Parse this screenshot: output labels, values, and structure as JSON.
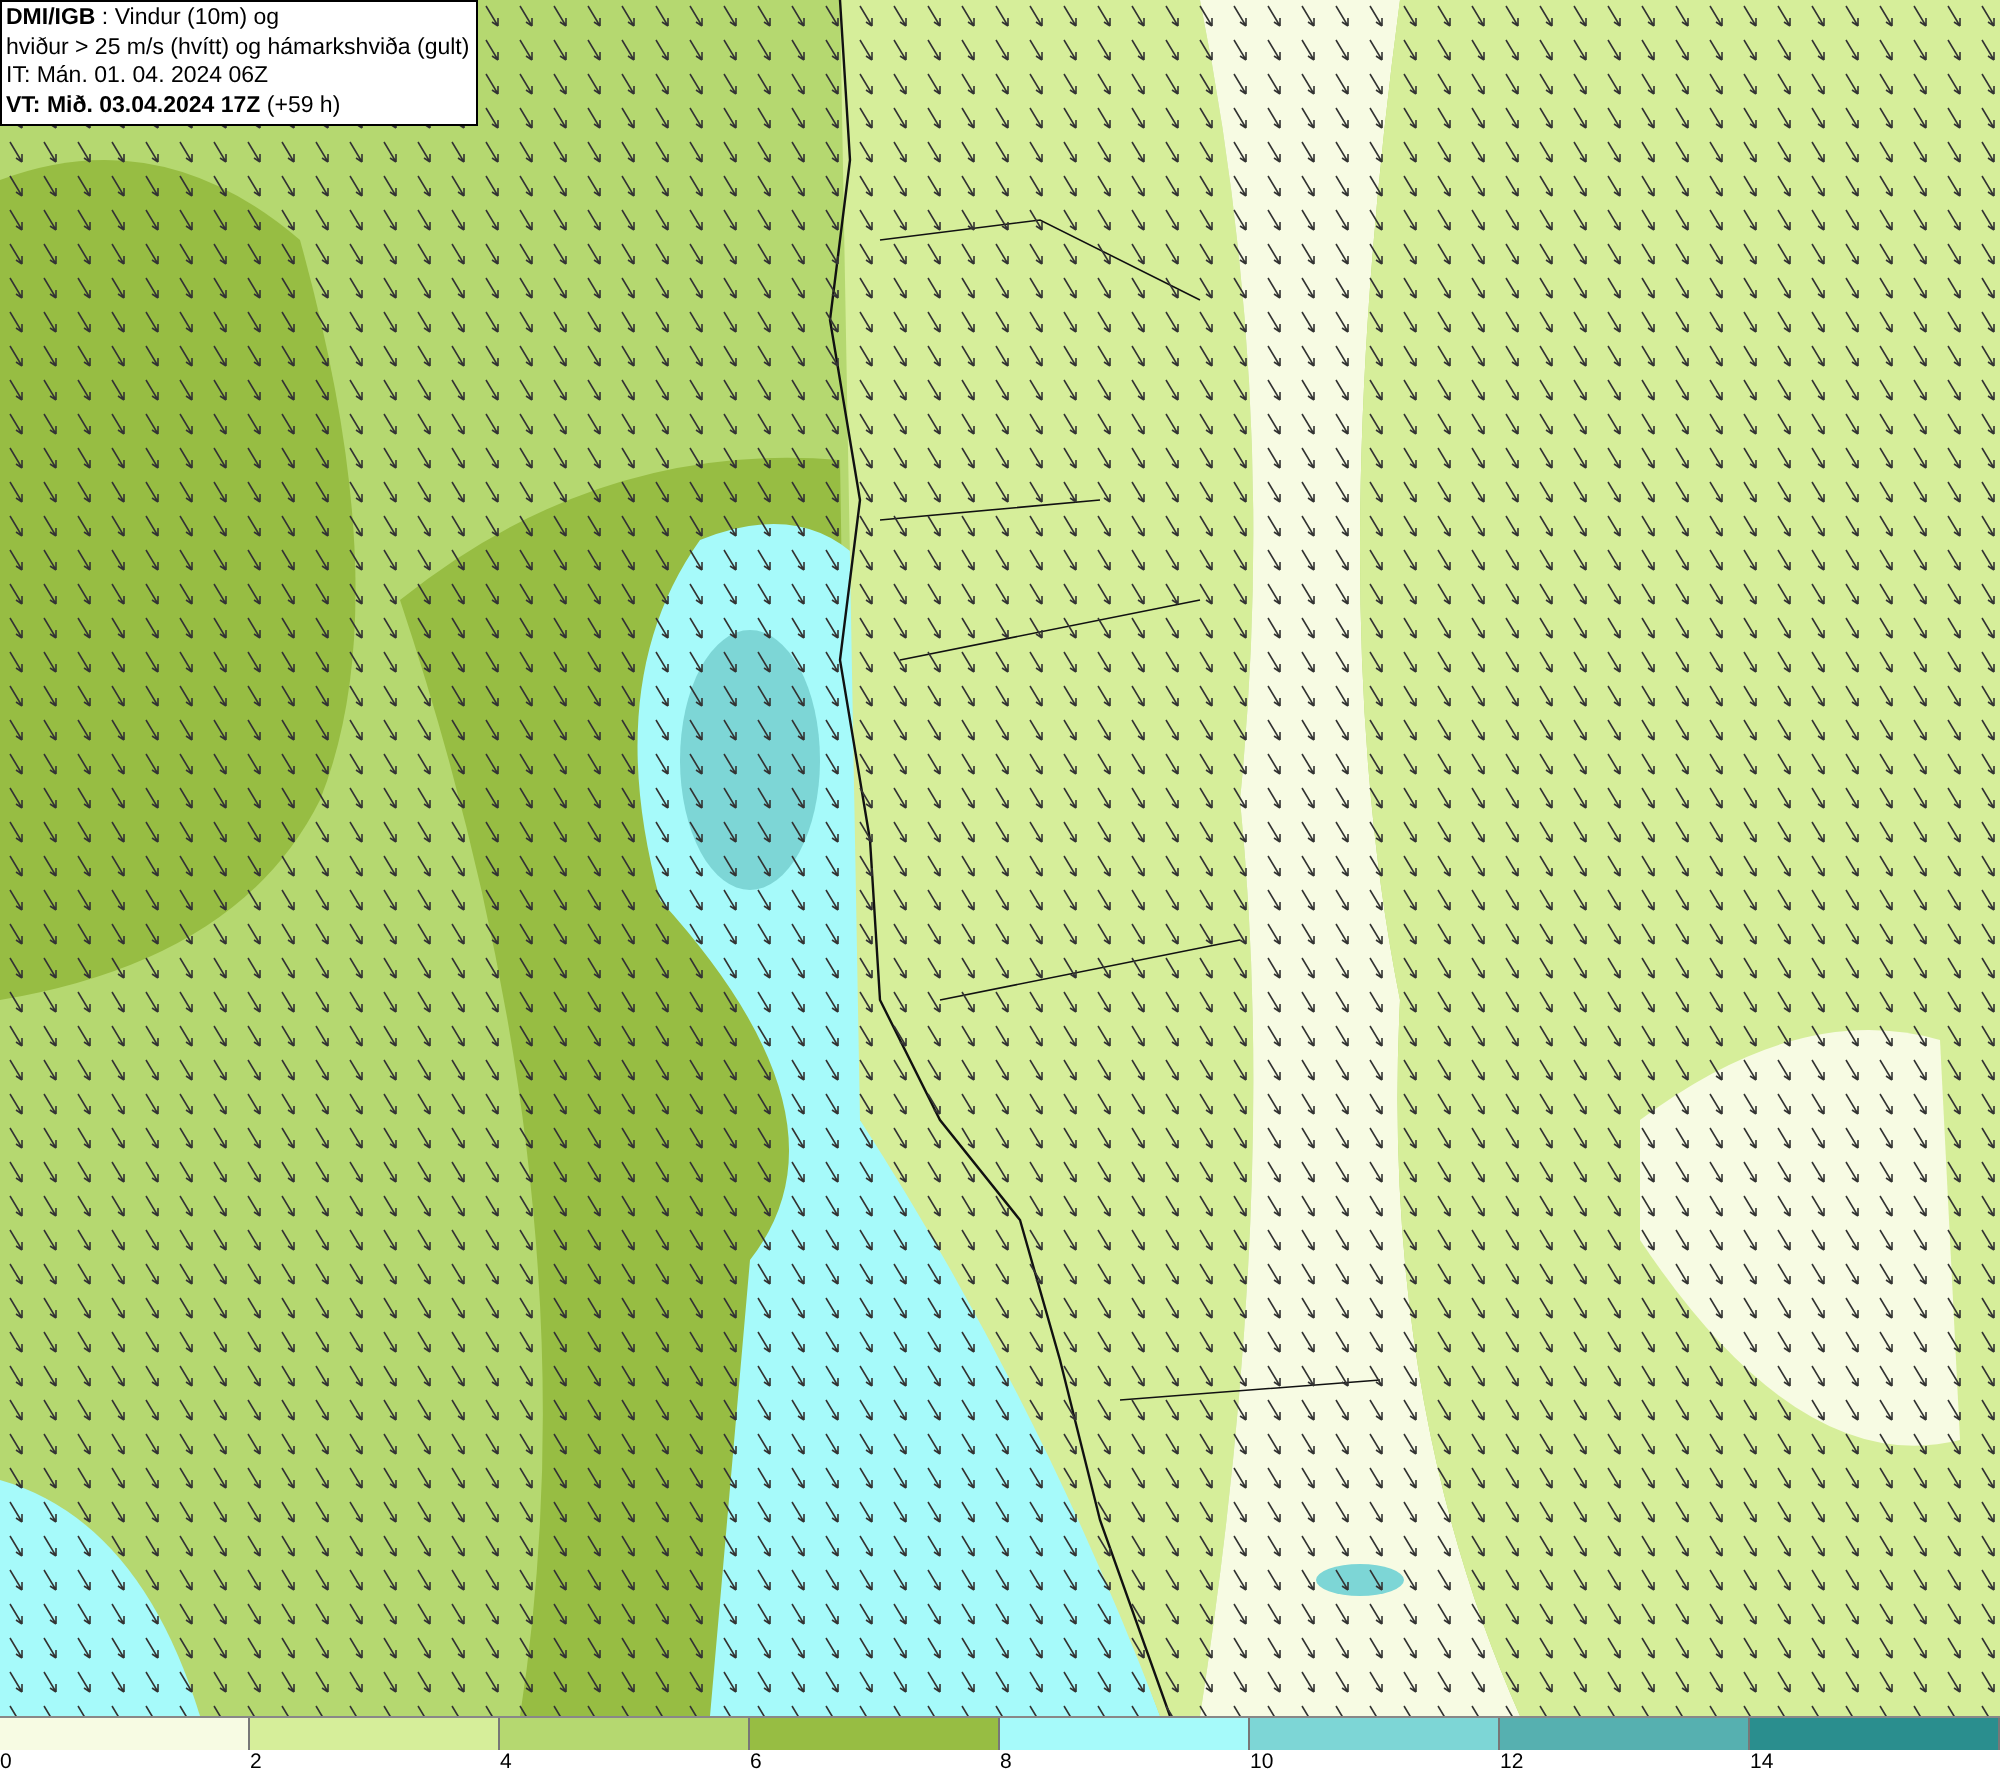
{
  "header": {
    "lines": [
      "**DMI/IGB** : Vindur (10m) og",
      "hviður > 25 m/s (hvítt) og hámarkshviða (gult)",
      "IT: Mán. 01. 04. 2024 06Z",
      "**VT: Mið. 03.04.2024 17Z** (+59 h)"
    ]
  },
  "legend": {
    "bins": [
      {
        "label": "0",
        "color": "#f7fbe3"
      },
      {
        "label": "2",
        "color": "#d6ee9a"
      },
      {
        "label": "4",
        "color": "#b5d870"
      },
      {
        "label": "6",
        "color": "#97bd43"
      },
      {
        "label": "8",
        "color": "#a6fafa"
      },
      {
        "label": "10",
        "color": "#7dd6d6"
      },
      {
        "label": "12",
        "color": "#56b0b0"
      },
      {
        "label": "14",
        "color": "#2a8e8e"
      }
    ]
  }
}
